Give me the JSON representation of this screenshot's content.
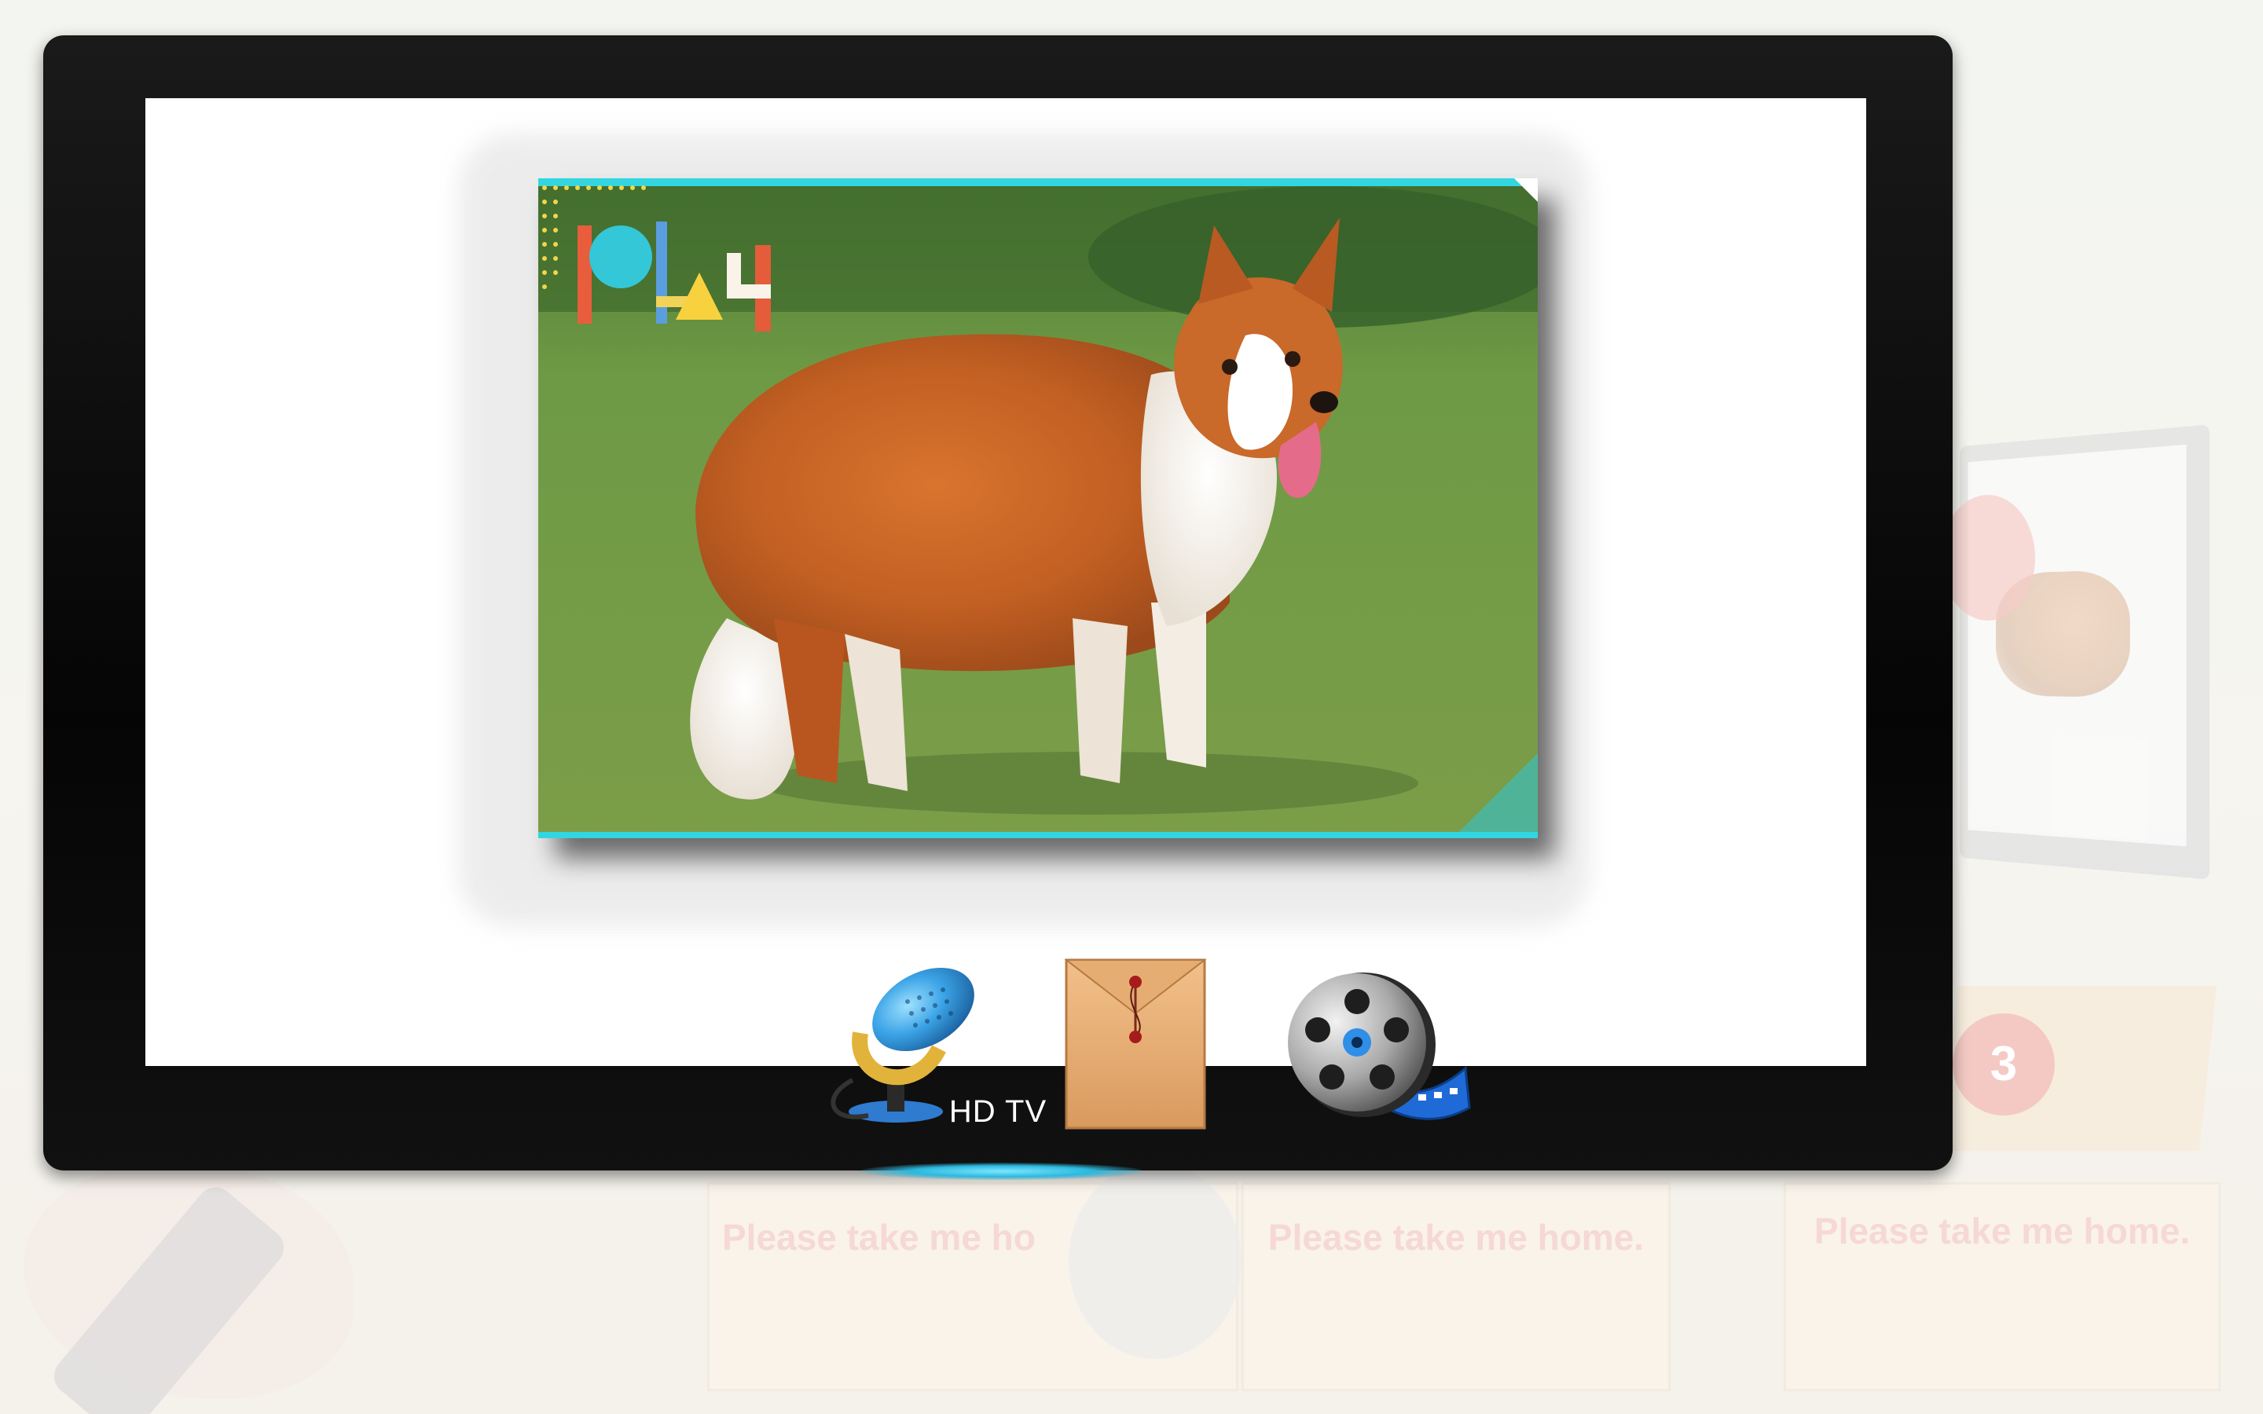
{
  "tv": {
    "brand_label": "HD TV"
  },
  "photo": {
    "logo_text": "play",
    "subject": "dog"
  },
  "icons": {
    "record": "microphone-icon",
    "envelope": "envelope-icon",
    "video": "film-reel-icon"
  },
  "background": {
    "box_text": "Please take me home.",
    "box_partial_text": "Please take me ho",
    "badge_number": "3"
  },
  "colors": {
    "accent": "#31d6e0",
    "tv_bezel": "#0a0a0a",
    "bg_text": "#f3c9c6"
  }
}
